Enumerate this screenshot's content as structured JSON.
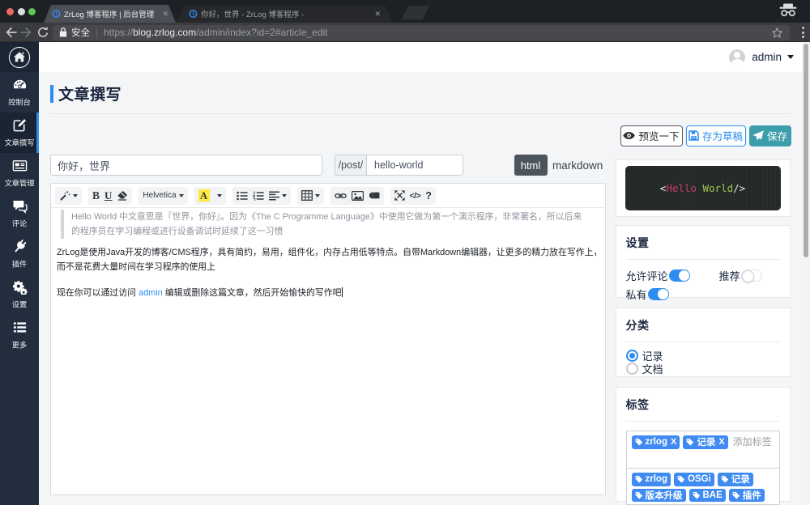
{
  "browser": {
    "window_controls": [
      "close",
      "minimize",
      "zoom"
    ],
    "tabs": [
      {
        "title": "ZrLog 博客程序 | 后台管理",
        "active": true,
        "close_label": "✕"
      },
      {
        "title": "你好，世界 - ZrLog 博客程序 -",
        "active": false,
        "close_label": "✕"
      }
    ],
    "address_bar": {
      "secure_label": "安全",
      "url_scheme": "https://",
      "url_host": "blog.zrlog.com",
      "url_path": "/admin/index?id=2#article_edit"
    }
  },
  "sidebar": {
    "items": [
      {
        "label": "控制台",
        "active": false
      },
      {
        "label": "文章撰写",
        "active": true
      },
      {
        "label": "文章管理",
        "active": false
      },
      {
        "label": "评论",
        "active": false
      },
      {
        "label": "插件",
        "active": false
      },
      {
        "label": "设置",
        "active": false
      },
      {
        "label": "更多",
        "active": false
      }
    ]
  },
  "topbar": {
    "username": "admin"
  },
  "page": {
    "title": "文章撰写"
  },
  "editor": {
    "title_value": "你好，世界",
    "alias_prefix": "/post/",
    "alias_value": "hello-world",
    "mode_html": "html",
    "mode_markdown": "markdown",
    "toolbar": {
      "bold": "B",
      "underline": "U",
      "font_name": "Helvetica",
      "color_letter": "A",
      "code_label": "</>",
      "help_label": "?"
    },
    "blockquote": "Hello World 中文意思是『世界，你好』。因为《The C Programme Language》中使用它做为第一个演示程序，非常著名，所以后来的程序员在学习编程或进行设备调试时延续了这一习惯",
    "paragraph1": "ZrLog是使用Java开发的博客/CMS程序，具有简约，易用，组件化，内存占用低等特点。自带Markdown编辑器，让更多的精力放在写作上，而不是花费大量时间在学习程序的使用上",
    "paragraph2_before": "现在你可以通过访问 ",
    "paragraph2_link": "admin",
    "paragraph2_after": " 编辑或删除这篇文章，然后开始愉快的写作吧"
  },
  "actions": {
    "preview": "预览一下",
    "save_draft": "存为草稿",
    "save": "保存"
  },
  "code_preview": {
    "open": "<",
    "tag": "Hello",
    "attr": "World",
    "close": "/>"
  },
  "settings_card": {
    "title": "设置",
    "toggles": [
      {
        "label": "允许评论",
        "on": true
      },
      {
        "label": "推荐",
        "on": false
      },
      {
        "label": "私有",
        "on": true
      }
    ]
  },
  "category_card": {
    "title": "分类",
    "options": [
      {
        "label": "记录",
        "selected": true
      },
      {
        "label": "文档",
        "selected": false
      }
    ]
  },
  "tags_card": {
    "title": "标签",
    "selected": [
      {
        "label": "zrlog",
        "remove_label": "X"
      },
      {
        "label": "记录",
        "remove_label": "X"
      }
    ],
    "placeholder": "添加标签",
    "options": [
      {
        "label": "zrlog"
      },
      {
        "label": "OSGi"
      },
      {
        "label": "记录"
      },
      {
        "label": "版本升级"
      },
      {
        "label": "BAE"
      },
      {
        "label": "插件"
      }
    ]
  },
  "colors": {
    "accent_blue": "#2d8cf0",
    "chip_blue": "#3f8bf2",
    "save_teal": "#3c9dab",
    "sidebar_navy": "#222d3d",
    "code_tag_pink": "#d0386d",
    "code_attr_green": "#a3c14e"
  }
}
